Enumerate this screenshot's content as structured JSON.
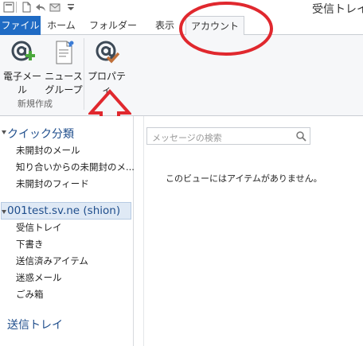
{
  "window": {
    "title": "受信トレイ"
  },
  "tabs": [
    {
      "label": "ファイル"
    },
    {
      "label": "ホーム"
    },
    {
      "label": "フォルダー"
    },
    {
      "label": "表示"
    },
    {
      "label": "アカウント"
    }
  ],
  "ribbon": {
    "email_label": "電子メール",
    "news_label_1": "ニュース",
    "news_label_2": "グループ",
    "group_label": "新規作成",
    "properties_label": "プロパティ"
  },
  "nav": {
    "quick": {
      "label": "クイック分類",
      "items": [
        "未開封のメール",
        "知り合いからの未開封のメ...",
        "未開封のフィード"
      ]
    },
    "account": {
      "label": "001test.sv.ne (shion)",
      "items": [
        "受信トレイ",
        "下書き",
        "送信済みアイテム",
        "迷惑メール",
        "ごみ箱"
      ]
    },
    "outbox": {
      "label": "送信トレイ"
    }
  },
  "main": {
    "search_placeholder": "メッセージの検索",
    "empty_message": "このビューにはアイテムがありません。"
  },
  "colors": {
    "file_tab": "#1f6bc4",
    "annotation": "#e0282e",
    "selected": "#dfe9f5"
  }
}
